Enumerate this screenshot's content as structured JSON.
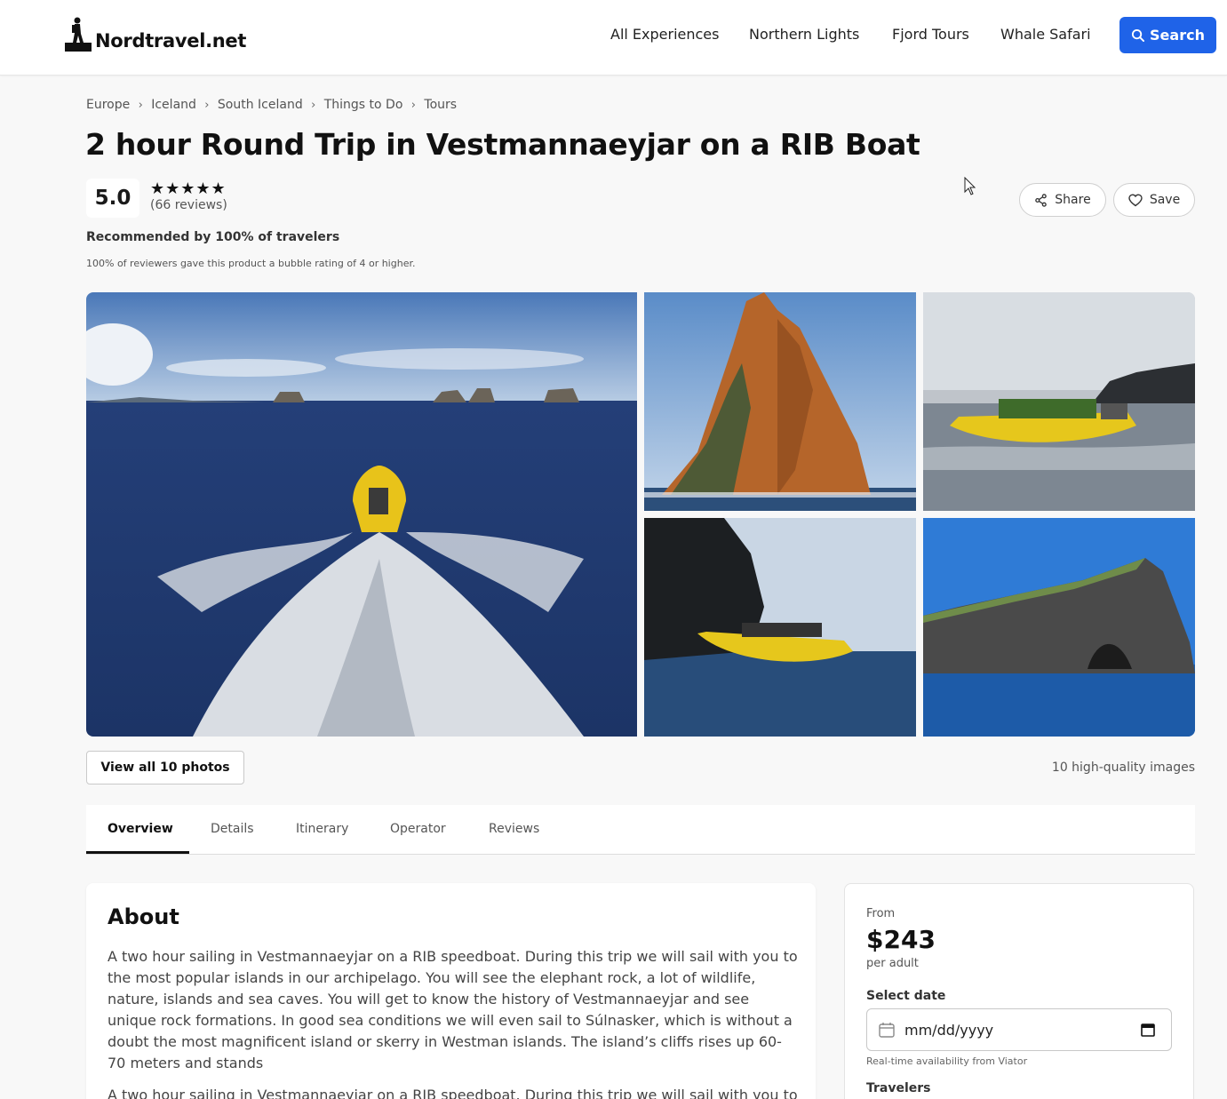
{
  "header": {
    "logo_text": "Nordtravel.net",
    "nav": [
      "All Experiences",
      "Northern Lights",
      "Fjord Tours",
      "Whale Safari"
    ],
    "search_label": "Search",
    "accent_color": "#1f63e8"
  },
  "breadcrumb": [
    "Europe",
    "Iceland",
    "South Iceland",
    "Things to Do",
    "Tours"
  ],
  "product": {
    "title": "2 hour Round Trip in Vestmannaeyjar on a RIB Boat",
    "rating": "5.0",
    "stars": "★★★★★",
    "reviews": "(66 reviews)",
    "recommend": "Recommended by 100% of travelers",
    "recommend_sub": "100% of reviewers gave this product a bubble rating of 4 or higher.",
    "share_label": "Share",
    "save_label": "Save"
  },
  "gallery": {
    "view_all_label": "View all 10 photos",
    "count_label": "10 high-quality images",
    "photos": [
      "rib-boat-wake",
      "sea-stack-rock",
      "rib-boat-passengers",
      "rib-boat-cliff",
      "elephant-rock-island"
    ]
  },
  "tabs": [
    "Overview",
    "Details",
    "Itinerary",
    "Operator",
    "Reviews"
  ],
  "about": {
    "heading": "About",
    "para1": "A two hour sailing in Vestmannaeyjar on a RIB speedboat. During this trip we will sail with you to the most popular islands in our archipelago. You will see the elephant rock, a lot of wildlife, nature, islands and sea caves. You will get to know the history of Vestmannaeyjar and see unique rock formations. In good sea conditions we will even sail to Súlnasker, which is without a doubt the most magnificent island or skerry in Westman islands. The island’s cliffs rises up 60-70 meters and stands",
    "para2": "A two hour sailing in Vestmannaeyjar on a RIB speedboat. During this trip we will sail with you to"
  },
  "booking": {
    "from": "From",
    "price": "$243",
    "per": "per adult",
    "date_label": "Select date",
    "date_placeholder": "mm/dd/yyyy",
    "availability": "Real-time availability from Viator",
    "travelers_label": "Travelers"
  }
}
